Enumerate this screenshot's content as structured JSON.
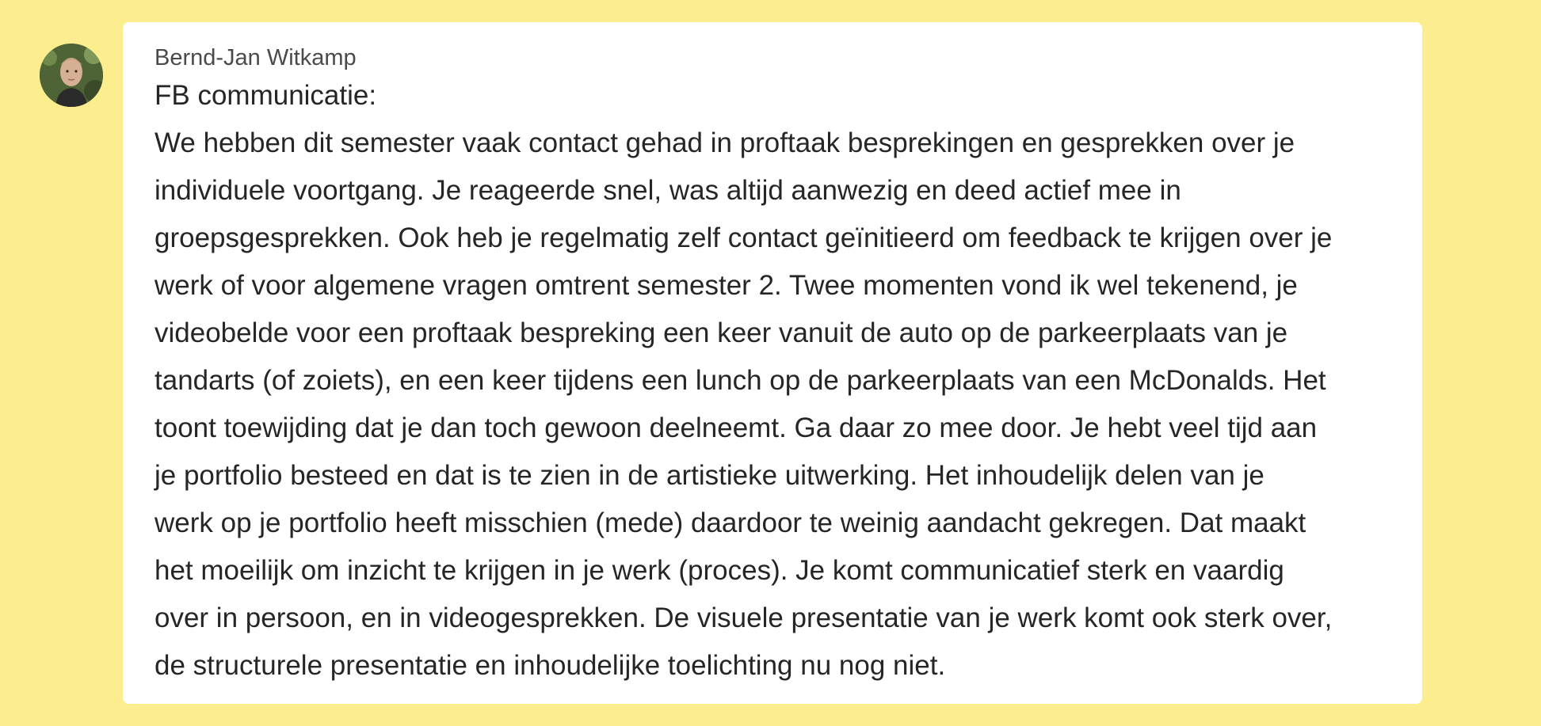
{
  "message": {
    "author": "Bernd-Jan Witkamp",
    "heading": "FB communicatie:",
    "lines": [
      "We hebben dit semester vaak contact gehad in proftaak besprekingen en gesprekken over je",
      "individuele voortgang. Je reageerde snel, was altijd aanwezig en deed actief mee in",
      "groepsgesprekken. Ook heb je regelmatig zelf contact geïnitieerd om feedback te krijgen over je",
      "werk of voor algemene vragen omtrent semester 2. Twee momenten vond ik wel tekenend, je",
      "videobelde voor een proftaak bespreking een keer vanuit de auto op de parkeerplaats van je",
      "tandarts (of zoiets), en een keer tijdens een lunch op de parkeerplaats van een McDonalds. Het",
      "toont toewijding dat je dan toch gewoon deelneemt. Ga daar zo mee door. Je hebt veel tijd aan",
      "je portfolio besteed en dat is te zien in de artistieke uitwerking. Het inhoudelijk delen van je",
      "werk op je portfolio heeft misschien (mede) daardoor te weinig aandacht gekregen. Dat maakt",
      "het moeilijk om inzicht te krijgen in je werk (proces). Je komt communicatief sterk en vaardig",
      "over in persoon, en in videogesprekken. De visuele presentatie van je werk komt ook sterk over,",
      "de structurele presentatie en inhoudelijke toelichting nu nog niet."
    ]
  },
  "colors": {
    "background": "#fcee8e",
    "card": "#ffffff",
    "author_text": "#4a4a4a",
    "body_text": "#262626"
  }
}
